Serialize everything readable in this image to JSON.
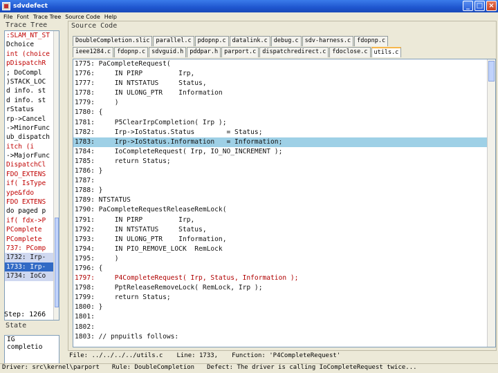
{
  "window": {
    "title": "sdvdefect",
    "controls": [
      "_",
      "□",
      "×"
    ]
  },
  "menu": [
    "File",
    "Font",
    "Trace Tree",
    "Source Code",
    "Help"
  ],
  "trace_panel": {
    "label": "Trace Tree",
    "items": [
      {
        "text": ":SLAM_NT_ST",
        "style": "red"
      },
      {
        "text": "Dchoice",
        "style": ""
      },
      {
        "text": "int (choice",
        "style": "red"
      },
      {
        "text": "pDispatchR",
        "style": "red"
      },
      {
        "text": "; DoCompl",
        "style": ""
      },
      {
        "text": ")STACK_LOC",
        "style": ""
      },
      {
        "text": "d info.   st",
        "style": ""
      },
      {
        "text": "d info.   st",
        "style": ""
      },
      {
        "text": "rStatus",
        "style": ""
      },
      {
        "text": "rp->Cancel",
        "style": ""
      },
      {
        "text": "->MinorFunc",
        "style": ""
      },
      {
        "text": "ub_dispatch",
        "style": ""
      },
      {
        "text": "itch (i",
        "style": "red"
      },
      {
        "text": "->MajorFunc",
        "style": ""
      },
      {
        "text": "DispatchCl",
        "style": "red"
      },
      {
        "text": "FDO_EXTENS",
        "style": "red"
      },
      {
        "text": "if( IsType",
        "style": "red"
      },
      {
        "text": "ype&fdo",
        "style": "red"
      },
      {
        "text": "FDO EXTENS",
        "style": "red"
      },
      {
        "text": "do paged p",
        "style": ""
      },
      {
        "text": "if( fdx->P",
        "style": "red"
      },
      {
        "text": "PComplete",
        "style": "red"
      },
      {
        "text": "PComplete",
        "style": "red"
      },
      {
        "text": "737: PComp",
        "style": "red"
      },
      {
        "text": "1732: Irp-",
        "style": "sel"
      },
      {
        "text": "1733: Irp-",
        "style": "selected"
      },
      {
        "text": "1734: IoCo",
        "style": "sel"
      }
    ],
    "step_label": "Step: 1266",
    "state_label": "State",
    "state_lines": [
      "IG",
      "completio"
    ]
  },
  "source_panel": {
    "label": "Source Code",
    "tabs_row1": [
      "DoubleCompletion.slic",
      "parallel.c",
      "pdopnp.c",
      "datalink.c",
      "debug.c",
      "sdv-harness.c",
      "fdopnp.c"
    ],
    "tabs_row2": [
      "ieee1284.c",
      "fdopnp.c",
      "sdvguid.h",
      "pddpar.h",
      "parport.c",
      "dispatchredirect.c",
      "fdoclose.c",
      "utils.c"
    ],
    "active_tab": "utils.c",
    "lines": [
      {
        "text": "1775: PaCompleteRequest(",
        "style": ""
      },
      {
        "text": "1776:     IN PIRP         Irp,",
        "style": ""
      },
      {
        "text": "1777:     IN NTSTATUS     Status,",
        "style": ""
      },
      {
        "text": "1778:     IN ULONG_PTR    Information",
        "style": ""
      },
      {
        "text": "1779:     )",
        "style": ""
      },
      {
        "text": "1780: {",
        "style": ""
      },
      {
        "text": "1781:     P5ClearIrpCompletion( Irp );",
        "style": ""
      },
      {
        "text": "1782:     Irp->IoStatus.Status        = Status;",
        "style": ""
      },
      {
        "text": "1783:     Irp->IoStatus.Information   = Information;",
        "style": "hl"
      },
      {
        "text": "1784:     IoCompleteRequest( Irp, IO_NO_INCREMENT );",
        "style": ""
      },
      {
        "text": "1785:     return Status;",
        "style": ""
      },
      {
        "text": "1786: }",
        "style": ""
      },
      {
        "text": "1787:",
        "style": ""
      },
      {
        "text": "1788: }",
        "style": ""
      },
      {
        "text": "1789: NTSTATUS",
        "style": ""
      },
      {
        "text": "1790: PaCompleteRequestReleaseRemLock(",
        "style": ""
      },
      {
        "text": "1791:     IN PIRP         Irp,",
        "style": ""
      },
      {
        "text": "1792:     IN NTSTATUS     Status,",
        "style": ""
      },
      {
        "text": "1793:     IN ULONG_PTR    Information,",
        "style": ""
      },
      {
        "text": "1794:     IN PIO_REMOVE_LOCK  RemLock",
        "style": ""
      },
      {
        "text": "1795:     )",
        "style": ""
      },
      {
        "text": "1796: {",
        "style": ""
      },
      {
        "text": "1797:     P4CompleteRequest( Irp, Status, Information );",
        "style": "red"
      },
      {
        "text": "1798:     PptReleaseRemoveLock( RemLock, Irp );",
        "style": ""
      },
      {
        "text": "1799:     return Status;",
        "style": ""
      },
      {
        "text": "1800: }",
        "style": ""
      },
      {
        "text": "1801:",
        "style": ""
      },
      {
        "text": "1802:",
        "style": ""
      },
      {
        "text": "1803: // pnpuitls follows:",
        "style": ""
      }
    ]
  },
  "info_bar": {
    "file": "File: ../../../../utils.c",
    "line": "Line: 1733,",
    "function": "Function: 'P4CompleteRequest'"
  },
  "status_bar": {
    "driver": "Driver: src\\kernel\\parport",
    "rule": "Rule: DoubleCompletion",
    "defect": "Defect: The driver is calling IoCompleteRequest twice..."
  }
}
